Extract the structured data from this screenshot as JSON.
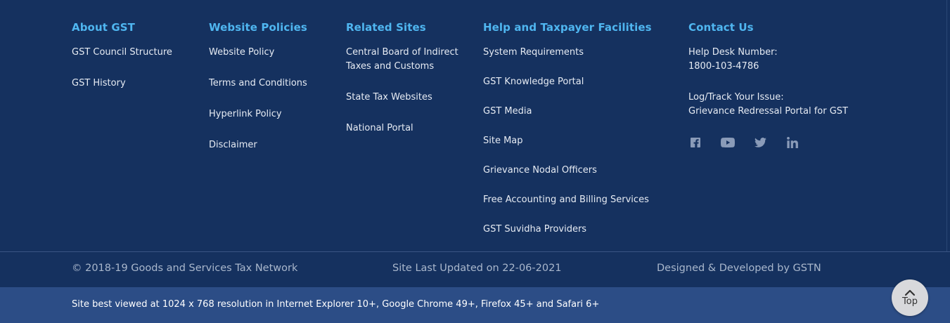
{
  "about": {
    "title": "About GST",
    "items": [
      "GST Council Structure",
      "GST History"
    ]
  },
  "policies": {
    "title": "Website Policies",
    "items": [
      "Website Policy",
      "Terms and Conditions",
      "Hyperlink Policy",
      "Disclaimer"
    ]
  },
  "related": {
    "title": "Related Sites",
    "items": [
      "Central Board of Indirect Taxes and Customs",
      "State Tax Websites",
      "National Portal"
    ]
  },
  "help": {
    "title": "Help and Taxpayer Facilities",
    "items": [
      "System Requirements",
      "GST Knowledge Portal",
      "GST Media",
      "Site Map",
      "Grievance Nodal Officers",
      "Free Accounting and Billing Services",
      "GST Suvidha Providers"
    ]
  },
  "contact": {
    "title": "Contact Us",
    "helpdesk_label": "Help Desk Number:",
    "helpdesk_number": "1800-103-4786",
    "issue_label": "Log/Track Your Issue:",
    "issue_link": "Grievance Redressal Portal for GST",
    "social_icons": [
      "facebook-icon",
      "youtube-icon",
      "twitter-icon",
      "linkedin-icon"
    ]
  },
  "bottom": {
    "copyright": "© 2018-19 Goods and Services Tax Network",
    "updated": "Site Last Updated on 22-06-2021",
    "designed": "Designed & Developed by GSTN"
  },
  "note": "Site best viewed at 1024 x 768 resolution in Internet Explorer 10+, Google Chrome 49+, Firefox 45+ and Safari 6+",
  "top_button": {
    "label": "Top"
  },
  "colors": {
    "background": "#15315f",
    "heading": "#4fb6f0",
    "note_bar": "#2c4d86"
  }
}
